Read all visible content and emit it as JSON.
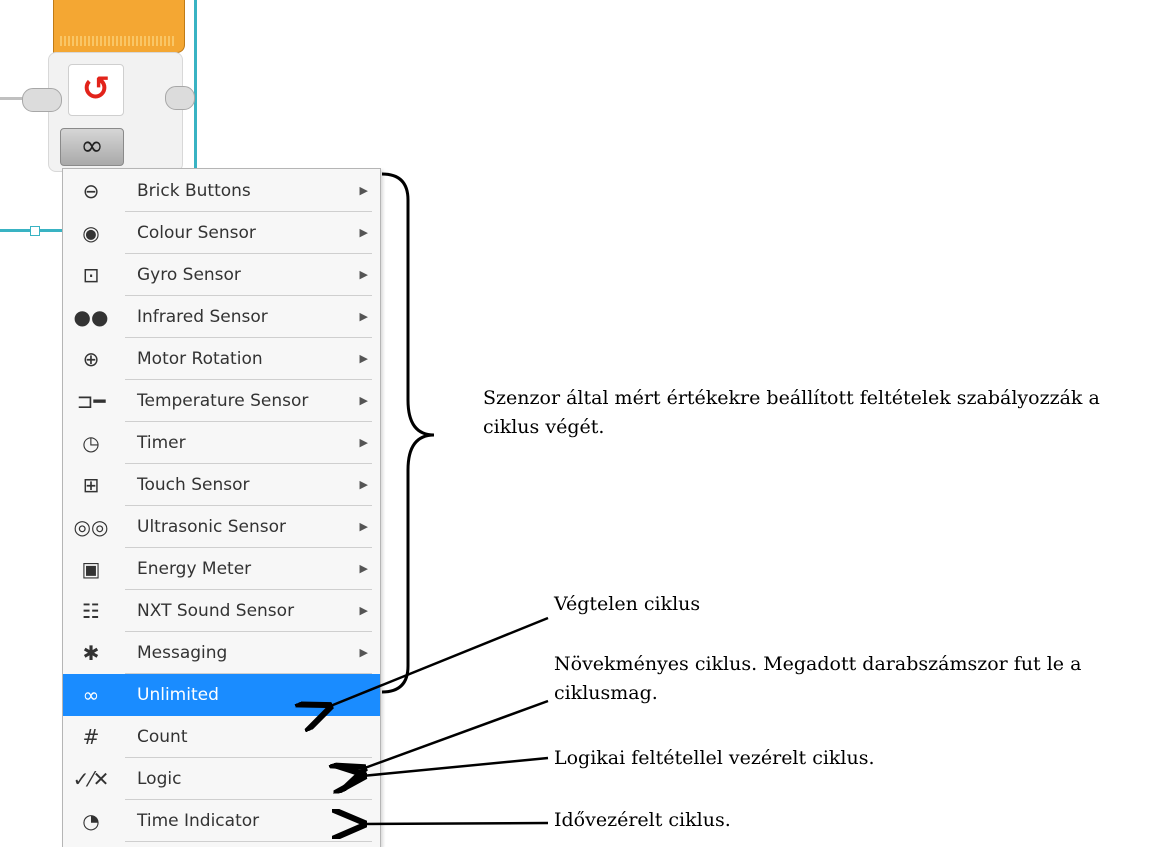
{
  "block": {
    "mode_symbol": "∞",
    "loop_symbol": "↺"
  },
  "menu": {
    "items": [
      {
        "label": "Brick Buttons",
        "icon": "brick-buttons-icon",
        "glyph": "⊖",
        "submenu": true
      },
      {
        "label": "Colour Sensor",
        "icon": "colour-sensor-icon",
        "glyph": "◉",
        "submenu": true
      },
      {
        "label": "Gyro Sensor",
        "icon": "gyro-sensor-icon",
        "glyph": "⊡",
        "submenu": true
      },
      {
        "label": "Infrared Sensor",
        "icon": "infrared-sensor-icon",
        "glyph": "●●",
        "submenu": true
      },
      {
        "label": "Motor Rotation",
        "icon": "motor-rotation-icon",
        "glyph": "⊕",
        "submenu": true
      },
      {
        "label": "Temperature Sensor",
        "icon": "temperature-sensor-icon",
        "glyph": "⊐━",
        "submenu": true
      },
      {
        "label": "Timer",
        "icon": "timer-icon",
        "glyph": "◷",
        "submenu": true
      },
      {
        "label": "Touch Sensor",
        "icon": "touch-sensor-icon",
        "glyph": "⊞",
        "submenu": true
      },
      {
        "label": "Ultrasonic Sensor",
        "icon": "ultrasonic-sensor-icon",
        "glyph": "◎◎",
        "submenu": true
      },
      {
        "label": "Energy Meter",
        "icon": "energy-meter-icon",
        "glyph": "▣",
        "submenu": true
      },
      {
        "label": "NXT Sound Sensor",
        "icon": "nxt-sound-sensor-icon",
        "glyph": "☷",
        "submenu": true
      },
      {
        "label": "Messaging",
        "icon": "messaging-icon",
        "glyph": "✱",
        "submenu": true
      },
      {
        "label": "Unlimited",
        "icon": "infinity-icon",
        "glyph": "∞",
        "submenu": false,
        "selected": true
      },
      {
        "label": "Count",
        "icon": "hash-icon",
        "glyph": "#",
        "submenu": false
      },
      {
        "label": "Logic",
        "icon": "logic-icon",
        "glyph": "✓⁄✕",
        "submenu": false
      },
      {
        "label": "Time Indicator",
        "icon": "time-indicator-icon",
        "glyph": "◔",
        "submenu": false
      }
    ],
    "submenu_arrow": "▶",
    "selected_color": "#1a8cff"
  },
  "annotations": {
    "sensor_note": "Szenzor által mért értékekre beállított feltételek szabályozzák a ciklus végét.",
    "unlimited_note": "Végtelen ciklus",
    "count_note": "Növekményes ciklus. Megadott darabszámszor fut le a ciklusmag.",
    "logic_note": "Logikai feltétellel vezérelt ciklus.",
    "time_note": "Idővezérelt ciklus."
  }
}
